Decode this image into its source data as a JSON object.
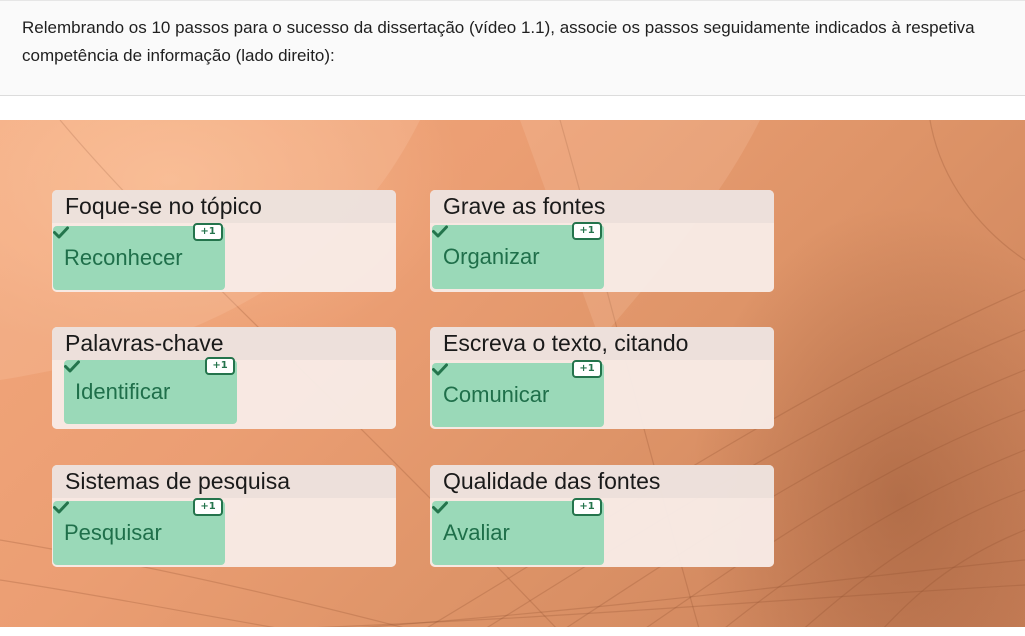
{
  "question": {
    "text": "Relembrando os 10 passos para o sucesso da dissertação (vídeo 1.1), associe os passos seguidamente indicados à respetiva competência de informação (lado direito):"
  },
  "colors": {
    "draggable_bg": "#9ad9b8",
    "draggable_text": "#1f6f4a",
    "correct_accent": "#24744c",
    "stage_bg": "#eb9e73"
  },
  "zones": [
    {
      "title": "Foque-se no tópico",
      "answer": "Reconhecer",
      "score": "+1",
      "status_icon": "check-icon"
    },
    {
      "title": "Grave as fontes",
      "answer": "Organizar",
      "score": "+1",
      "status_icon": "check-icon"
    },
    {
      "title": "Palavras-chave",
      "answer": "Identificar",
      "score": "+1",
      "status_icon": "check-icon"
    },
    {
      "title": "Escreva o texto, citando",
      "answer": "Comunicar",
      "score": "+1",
      "status_icon": "check-icon"
    },
    {
      "title": "Sistemas de pesquisa",
      "answer": "Pesquisar",
      "score": "+1",
      "status_icon": "check-icon"
    },
    {
      "title": "Qualidade das fontes",
      "answer": "Avaliar",
      "score": "+1",
      "status_icon": "check-icon"
    }
  ]
}
